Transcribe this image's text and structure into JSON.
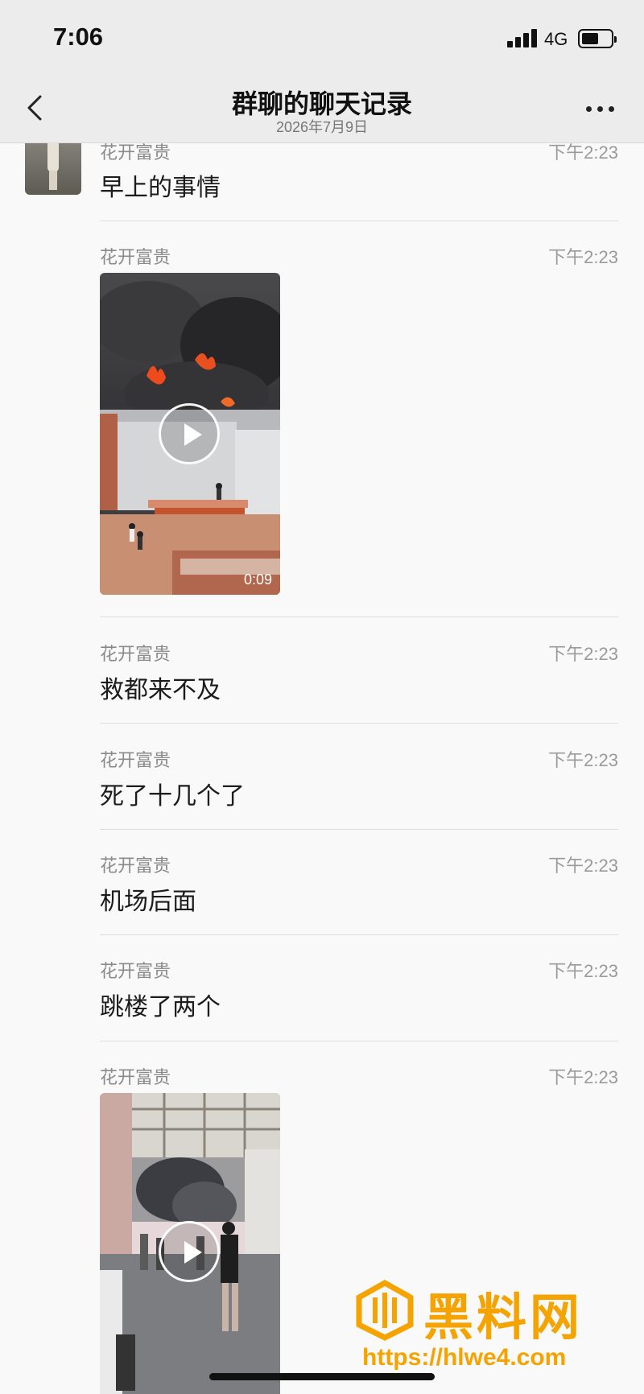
{
  "status_bar": {
    "time": "7:06",
    "network": "4G",
    "battery_percent": 50
  },
  "nav": {
    "title": "群聊的聊天记录",
    "subtitle": "2026年7月9日"
  },
  "messages": [
    {
      "sender": "花开富贵",
      "time": "下午2:23",
      "text": "早上的事情"
    },
    {
      "sender": "花开富贵",
      "time": "下午2:23",
      "video_duration": "0:09"
    },
    {
      "sender": "花开富贵",
      "time": "下午2:23",
      "text": "救都来不及"
    },
    {
      "sender": "花开富贵",
      "time": "下午2:23",
      "text": "死了十几个了"
    },
    {
      "sender": "花开富贵",
      "time": "下午2:23",
      "text": "机场后面"
    },
    {
      "sender": "花开富贵",
      "time": "下午2:23",
      "text": "跳楼了两个"
    },
    {
      "sender": "花开富贵",
      "time": "下午2:23"
    }
  ],
  "watermark": {
    "title": "黑料网",
    "url": "https://hlwe4.com"
  },
  "colors": {
    "watermark": "#f5a300",
    "nav_bg": "#ececec",
    "page_bg": "#f9f9f9"
  }
}
